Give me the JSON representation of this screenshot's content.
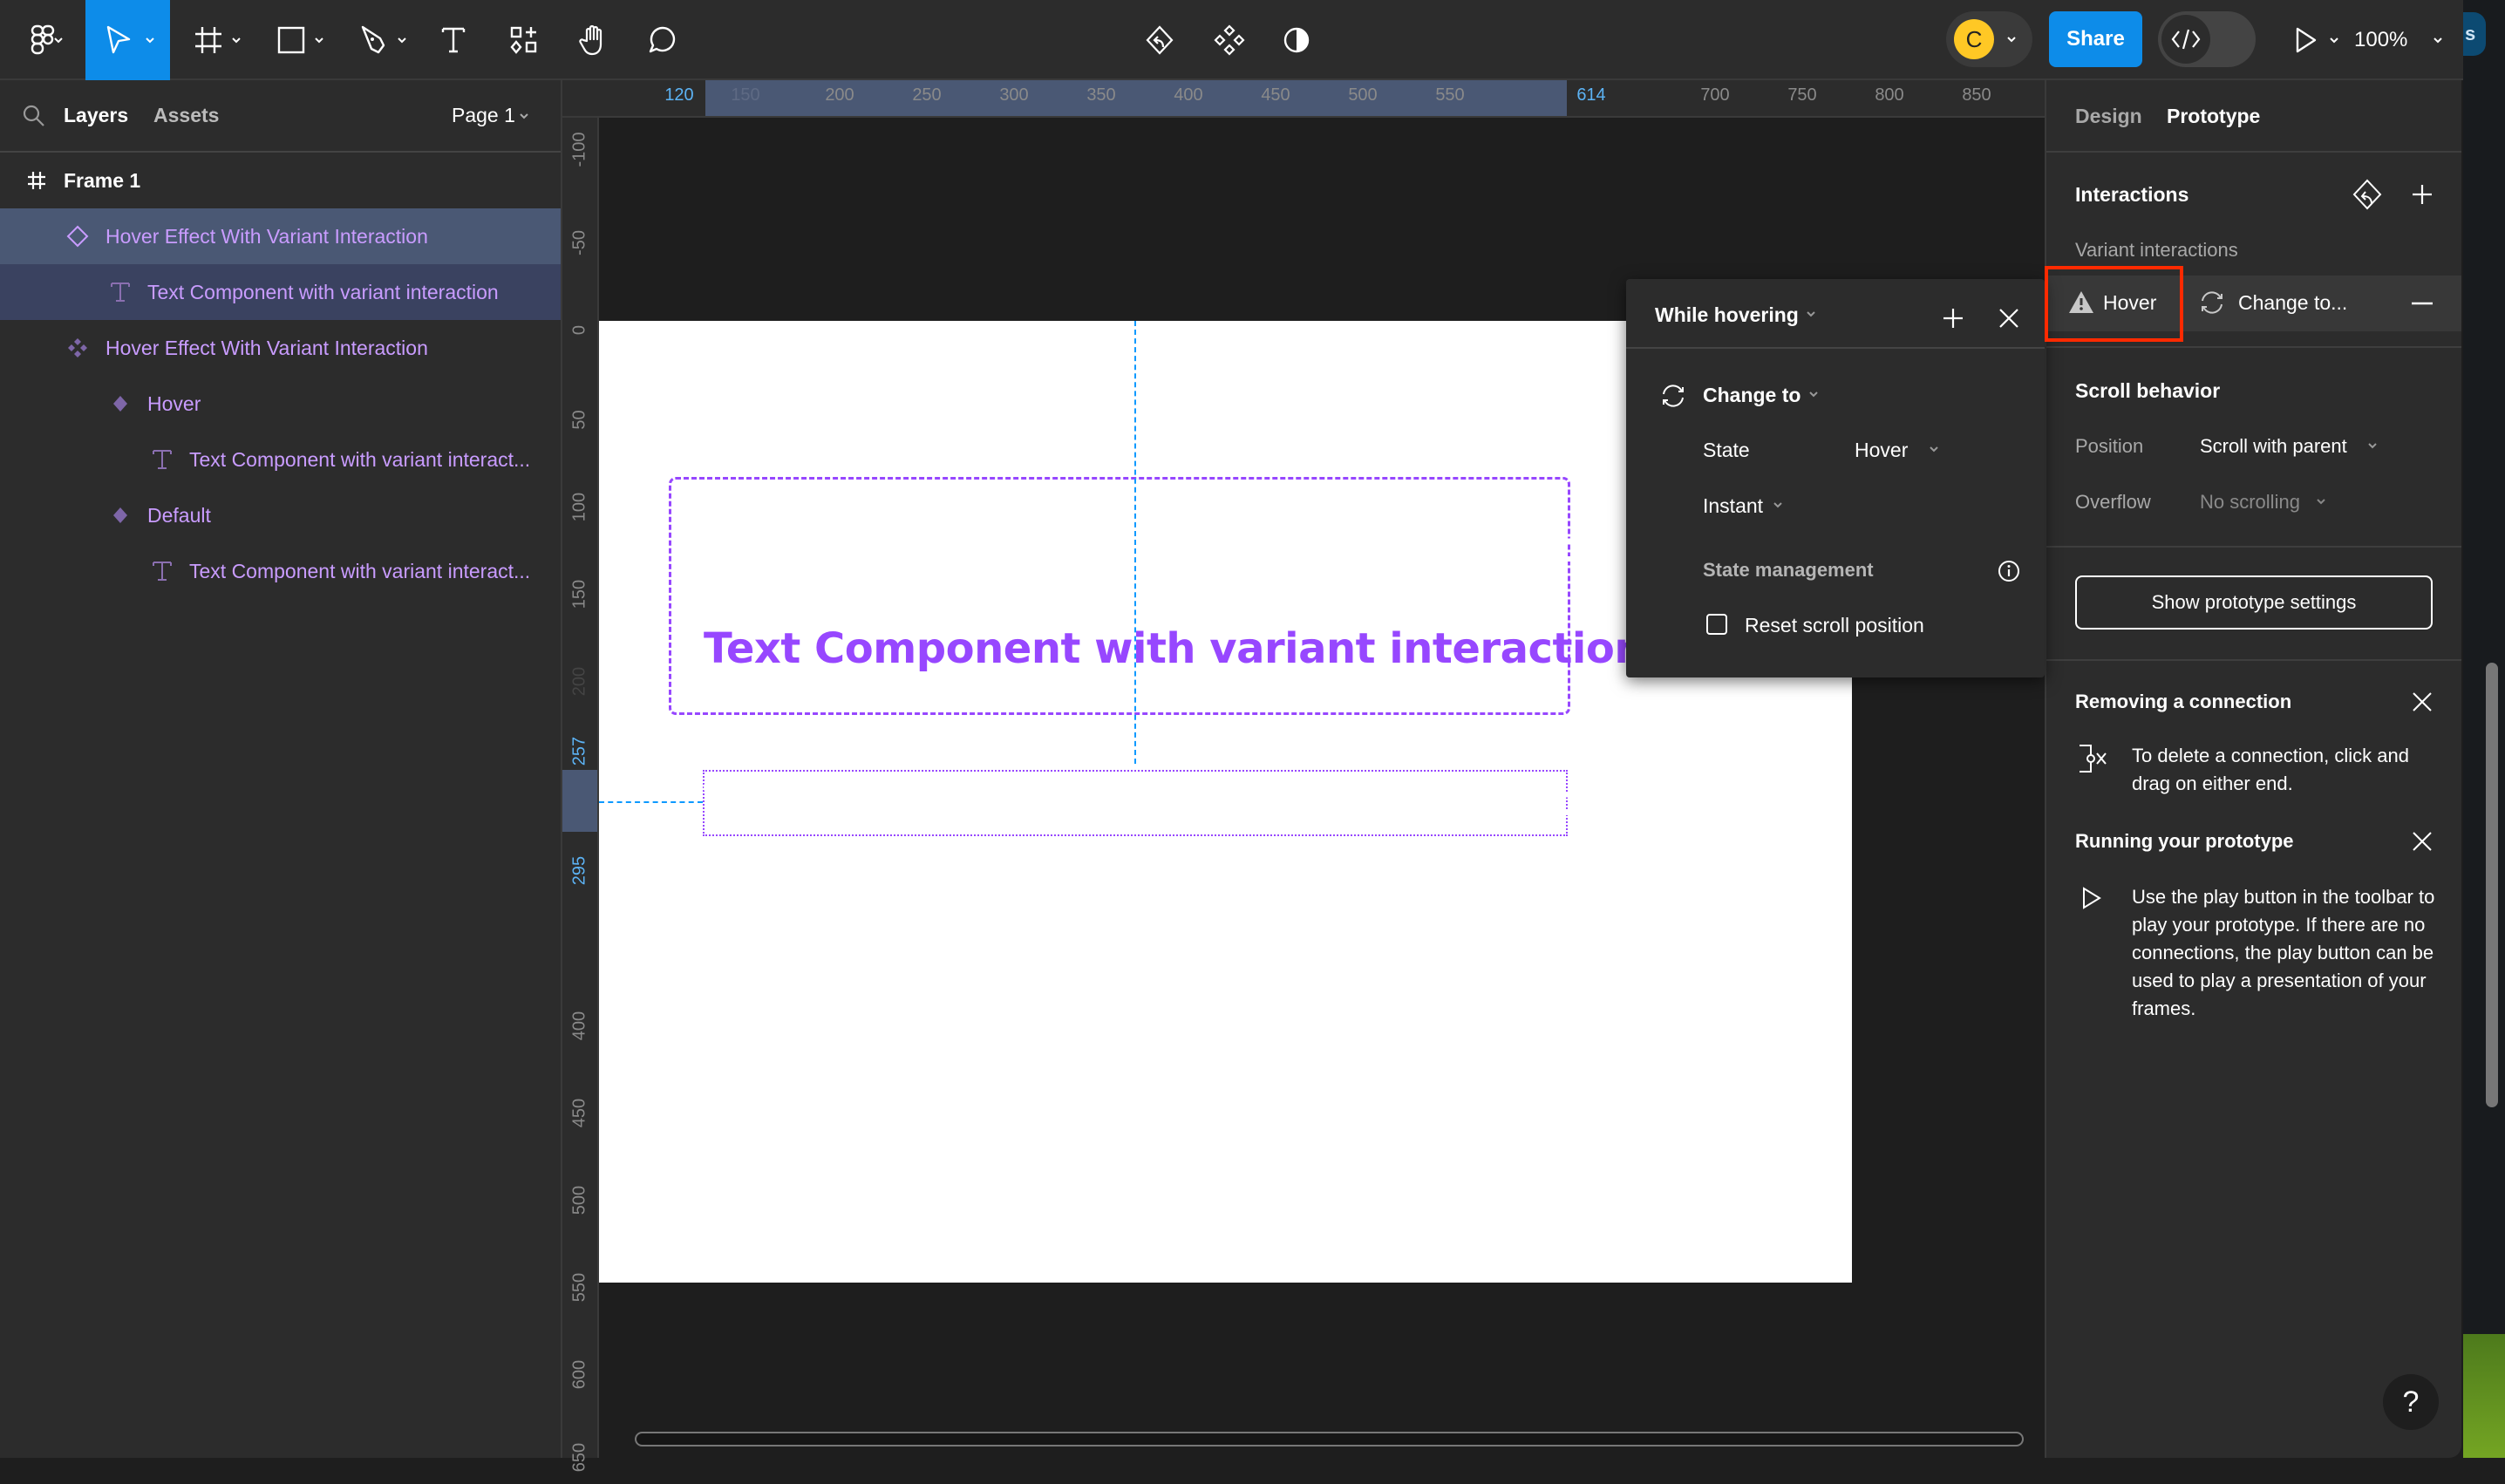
{
  "toolbar": {
    "tools": [
      {
        "name": "main-menu",
        "icon": "figma-logo-icon"
      },
      {
        "name": "move-tool",
        "icon": "cursor-arrow-icon",
        "active": true
      },
      {
        "name": "frame-tool",
        "icon": "frame-hash-icon"
      },
      {
        "name": "shape-tool",
        "icon": "rectangle-icon"
      },
      {
        "name": "pen-tool",
        "icon": "pen-icon"
      },
      {
        "name": "text-tool",
        "icon": "text-t-icon"
      },
      {
        "name": "resources-tool",
        "icon": "resources-icon"
      },
      {
        "name": "hand-tool",
        "icon": "hand-icon"
      },
      {
        "name": "comment-tool",
        "icon": "comment-bubble-icon"
      }
    ],
    "center_icons": [
      "reset-interactions-icon",
      "component-icon",
      "contrast-icon"
    ],
    "avatar_initial": "C",
    "avatar_color": "#ffc825",
    "share_label": "Share",
    "share_color": "#0d8ce9",
    "dev_mode_icon": "code-brackets-icon",
    "present_icon": "play-icon",
    "zoom_label": "100%"
  },
  "left_panel": {
    "tabs": {
      "layers": "Layers",
      "assets": "Assets"
    },
    "page_selector": "Page 1",
    "layers": [
      {
        "label": "Frame 1",
        "icon": "frame-hash-icon",
        "kind": "frame",
        "depth": 0
      },
      {
        "label": "Hover Effect With Variant Interaction",
        "icon": "instance-diamond-icon",
        "kind": "instance",
        "depth": 1,
        "selected": true
      },
      {
        "label": "Text Component with variant interaction",
        "icon": "text-t-icon",
        "kind": "text",
        "depth": 2,
        "child_selected": true
      },
      {
        "label": "Hover Effect With Variant Interaction",
        "icon": "component-set-icon",
        "kind": "component-set",
        "depth": 1
      },
      {
        "label": "Hover",
        "icon": "variant-diamond-icon",
        "kind": "variant",
        "depth": 2
      },
      {
        "label": "Text Component with variant interact...",
        "icon": "text-t-icon",
        "kind": "text",
        "depth": 3
      },
      {
        "label": "Default",
        "icon": "variant-diamond-icon",
        "kind": "variant",
        "depth": 2
      },
      {
        "label": "Text Component with variant interact...",
        "icon": "text-t-icon",
        "kind": "text",
        "depth": 3
      }
    ]
  },
  "rulers": {
    "top": [
      "120",
      "150",
      "200",
      "250",
      "300",
      "350",
      "400",
      "450",
      "500",
      "550",
      "614",
      "700",
      "750",
      "800",
      "850"
    ],
    "top_highlight": [
      "120",
      "614"
    ],
    "left": [
      "-100",
      "-50",
      "0",
      "50",
      "100",
      "150",
      "200",
      "257",
      "295",
      "400",
      "450",
      "500",
      "550",
      "600",
      "650"
    ],
    "left_highlight": [
      "257",
      "295"
    ]
  },
  "canvas": {
    "component_set_texts": [
      {
        "text": "Text Component with variant interaction",
        "color": "#000000"
      },
      {
        "text": "Text Component with variant interaction",
        "color": "#9747ff"
      }
    ],
    "instance_text": "Text Component with variant interaction",
    "component_border_color": "#9747ff",
    "guide_color": "#0d99ff"
  },
  "interaction_popup": {
    "trigger": "While hovering",
    "action": "Change to",
    "state_label": "State",
    "state_value": "Hover",
    "animation": "Instant",
    "state_management_label": "State management",
    "reset_scroll_label": "Reset scroll position",
    "reset_scroll_checked": false
  },
  "right_panel": {
    "tabs": {
      "design": "Design",
      "prototype": "Prototype"
    },
    "active_tab": "Prototype",
    "interactions_title": "Interactions",
    "variant_interactions_label": "Variant interactions",
    "interaction_row": {
      "trigger": "Hover",
      "action": "Change to...",
      "warning": true
    },
    "scroll_behavior_title": "Scroll behavior",
    "position_label": "Position",
    "position_value": "Scroll with parent",
    "overflow_label": "Overflow",
    "overflow_value": "No scrolling",
    "show_settings_button": "Show prototype settings",
    "tips": [
      {
        "title": "Removing a connection",
        "body": "To delete a connection, click and drag on either end.",
        "icon": "connection-delete-icon"
      },
      {
        "title": "Running your prototype",
        "body": "Use the play button in the toolbar to play your prototype. If there are no connections, the play button can be used to play a presentation of your frames.",
        "icon": "play-icon"
      }
    ],
    "help_label": "?"
  },
  "highlight_box_color": "#ff2a00"
}
